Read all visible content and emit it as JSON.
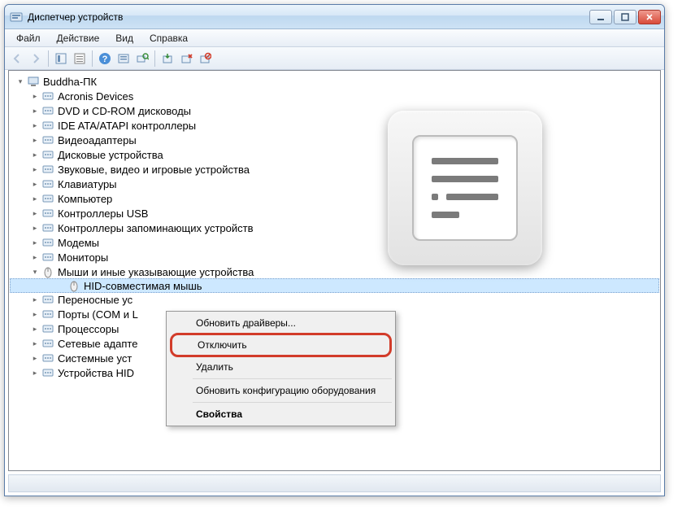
{
  "window": {
    "title": "Диспетчер устройств"
  },
  "menu": {
    "file": "Файл",
    "action": "Действие",
    "view": "Вид",
    "help": "Справка"
  },
  "tree": {
    "root": "Buddha-ПК",
    "nodes": [
      {
        "label": "Acronis Devices",
        "expanded": false
      },
      {
        "label": "DVD и CD-ROM дисководы",
        "expanded": false
      },
      {
        "label": "IDE ATA/ATAPI контроллеры",
        "expanded": false
      },
      {
        "label": "Видеоадаптеры",
        "expanded": false
      },
      {
        "label": "Дисковые устройства",
        "expanded": false
      },
      {
        "label": "Звуковые, видео и игровые устройства",
        "expanded": false
      },
      {
        "label": "Клавиатуры",
        "expanded": false
      },
      {
        "label": "Компьютер",
        "expanded": false
      },
      {
        "label": "Контроллеры USB",
        "expanded": false
      },
      {
        "label": "Контроллеры запоминающих устройств",
        "expanded": false
      },
      {
        "label": "Модемы",
        "expanded": false
      },
      {
        "label": "Мониторы",
        "expanded": false
      },
      {
        "label": "Мыши и иные указывающие устройства",
        "expanded": true,
        "children": [
          {
            "label": "HID-совместимая мышь",
            "selected": true
          }
        ]
      },
      {
        "label": "Переносные ус",
        "expanded": false
      },
      {
        "label": "Порты (COM и L",
        "expanded": false
      },
      {
        "label": "Процессоры",
        "expanded": false
      },
      {
        "label": "Сетевые адапте",
        "expanded": false
      },
      {
        "label": "Системные уст",
        "expanded": false
      },
      {
        "label": "Устройства HID",
        "expanded": false
      }
    ]
  },
  "context_menu": {
    "update_drivers": "Обновить драйверы...",
    "disable": "Отключить",
    "delete": "Удалить",
    "scan": "Обновить конфигурацию оборудования",
    "properties": "Свойства"
  }
}
